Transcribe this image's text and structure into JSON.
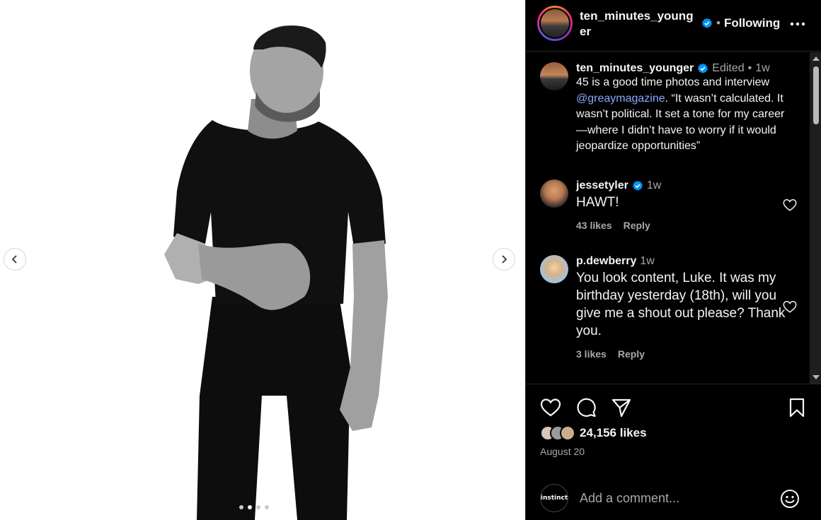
{
  "post": {
    "author": "ten_minutes_younger",
    "verified": true,
    "follow_status": "Following",
    "separator": "•",
    "carousel": {
      "slide_count": 4,
      "active_index": 1
    }
  },
  "caption": {
    "username": "ten_minutes_younger",
    "edited": "Edited",
    "dot": "•",
    "time": "1w",
    "text_before": "45 is a good time  photos and interview ",
    "mention": "@greaymagazine",
    "text_after": ". “It wasn’t calculated. It wasn’t political. It set a tone for my career—where I didn’t have to worry if it would jeopardize opportunities”"
  },
  "comments": [
    {
      "username": "jessetyler",
      "verified": true,
      "time": "1w",
      "text": "HAWT!",
      "likes": "43 likes",
      "reply": "Reply"
    },
    {
      "username": "p.dewberry",
      "verified": false,
      "time": "1w",
      "text": "You look content, Luke. It was my birthday yesterday (18th), will you give me a shout out please? Thank you.",
      "likes": "3 likes",
      "reply": "Reply"
    }
  ],
  "engagement": {
    "likes": "24,156 likes",
    "date": "August 20"
  },
  "composer": {
    "avatar_text": "instinct",
    "placeholder": "Add a comment..."
  },
  "icons": {
    "prev": "chevron-left-icon",
    "next": "chevron-right-icon",
    "more": "more-horizontal-icon",
    "like": "heart-icon",
    "comment": "comment-bubble-icon",
    "share": "paper-plane-icon",
    "save": "bookmark-icon",
    "emoji": "smiley-icon"
  },
  "colors": {
    "accent_link": "#8aa6ff",
    "verified_blue": "#0095f6",
    "background": "#000000",
    "muted_text": "#a8a8a8"
  }
}
